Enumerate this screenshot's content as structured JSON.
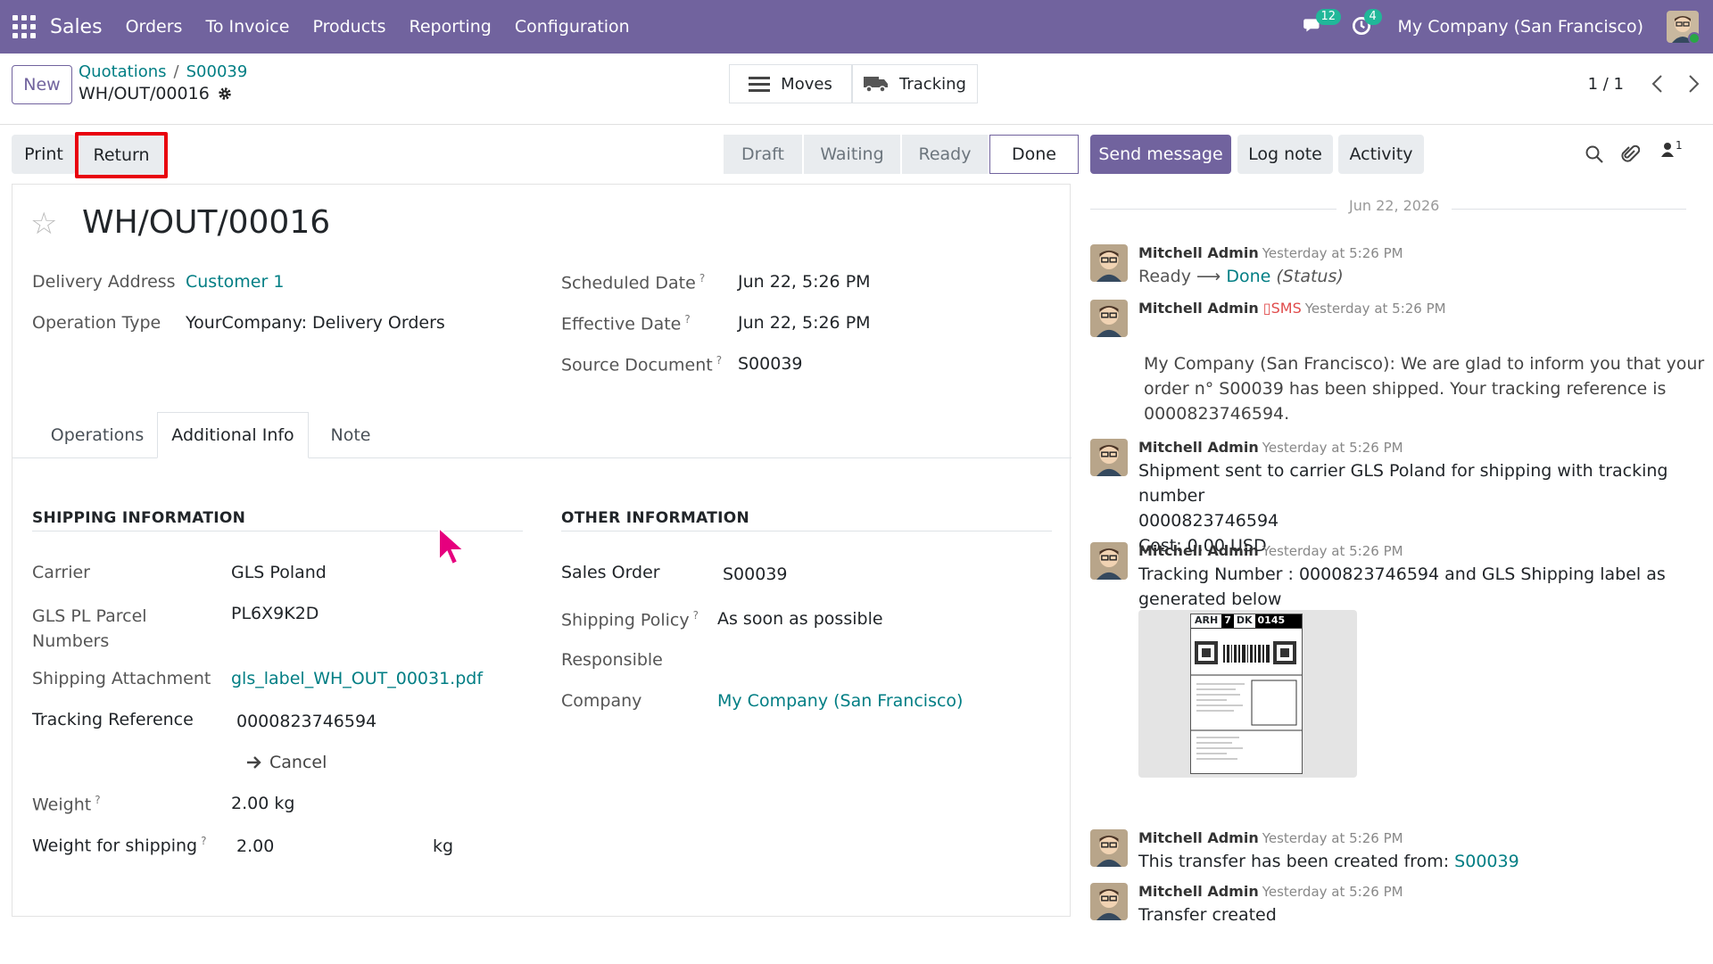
{
  "topbar": {
    "app_name": "Sales",
    "menu": [
      "Orders",
      "To Invoice",
      "Products",
      "Reporting",
      "Configuration"
    ],
    "messages_badge": "12",
    "activities_badge": "4",
    "company": "My Company (San Francisco)"
  },
  "control_panel": {
    "new_label": "New",
    "breadcrumb_parent": "Quotations",
    "breadcrumb_sep": "/",
    "breadcrumb_order": "S00039",
    "current_record": "WH/OUT/00016",
    "moves_label": "Moves",
    "tracking_label": "Tracking",
    "pager": "1 / 1"
  },
  "actions": {
    "print_label": "Print",
    "return_label": "Return",
    "stages": [
      "Draft",
      "Waiting",
      "Ready",
      "Done"
    ],
    "active_stage": "Done",
    "send_message": "Send message",
    "log_note": "Log note",
    "activity": "Activity",
    "followers_count": "1"
  },
  "record": {
    "title": "WH/OUT/00016",
    "delivery_address_label": "Delivery Address",
    "delivery_address": "Customer 1",
    "operation_type_label": "Operation Type",
    "operation_type": "YourCompany: Delivery Orders",
    "scheduled_date_label": "Scheduled Date",
    "scheduled_date": "Jun 22, 5:26 PM",
    "effective_date_label": "Effective Date",
    "effective_date": "Jun 22, 5:26 PM",
    "source_document_label": "Source Document",
    "source_document": "S00039"
  },
  "tabs": [
    "Operations",
    "Additional Info",
    "Note"
  ],
  "shipping": {
    "heading": "SHIPPING INFORMATION",
    "carrier_label": "Carrier",
    "carrier": "GLS Poland",
    "parcel_label_1": "GLS PL Parcel",
    "parcel_label_2": "Numbers",
    "parcel": "PL6X9K2D",
    "attachment_label": "Shipping Attachment",
    "attachment": "gls_label_WH_OUT_00031.pdf",
    "tracking_label": "Tracking Reference",
    "tracking": "0000823746594",
    "cancel_label": "Cancel",
    "weight_label": "Weight",
    "weight": "2.00 kg",
    "weight_shipping_label": "Weight for shipping",
    "weight_shipping": "2.00",
    "weight_unit": "kg"
  },
  "other": {
    "heading": "OTHER INFORMATION",
    "sales_order_label": "Sales Order",
    "sales_order": "S00039",
    "policy_label": "Shipping Policy",
    "policy": "As soon as possible",
    "responsible_label": "Responsible",
    "company_label": "Company",
    "company": "My Company (San Francisco)"
  },
  "chatter": {
    "date": "Jun 22, 2026",
    "messages": [
      {
        "author": "Mitchell Admin",
        "time": "Yesterday at 5:26 PM",
        "from": "Ready",
        "to": "Done",
        "field": "(Status)"
      },
      {
        "author": "Mitchell Admin",
        "sms": "SMS",
        "time": "Yesterday at 5:26 PM",
        "line1": "My Company (San Francisco): We are glad to inform you that your",
        "line2": "order n° S00039 has been shipped. Your tracking reference is",
        "line3": "0000823746594."
      },
      {
        "author": "Mitchell Admin",
        "time": "Yesterday at 5:26 PM",
        "line1": "Shipment sent to carrier GLS Poland for shipping with tracking number",
        "line2": "0000823746594",
        "line3": "Cost: 0.00 USD"
      },
      {
        "author": "Mitchell Admin",
        "time": "Yesterday at 5:26 PM",
        "line1": "Tracking Number : 0000823746594 and GLS Shipping label as",
        "line2": "generated below",
        "label_code1": "ARH",
        "label_code2": "7",
        "label_code3": "DK",
        "label_code4": "0145"
      },
      {
        "author": "Mitchell Admin",
        "time": "Yesterday at 5:26 PM",
        "line1": "This transfer has been created from:",
        "link": "S00039"
      },
      {
        "author": "Mitchell Admin",
        "time": "Yesterday at 5:26 PM",
        "line1": "Transfer created"
      }
    ]
  },
  "colors": {
    "brand": "#71639e",
    "link": "#017e84",
    "highlight": "#e8000c",
    "badge": "#21b799"
  }
}
